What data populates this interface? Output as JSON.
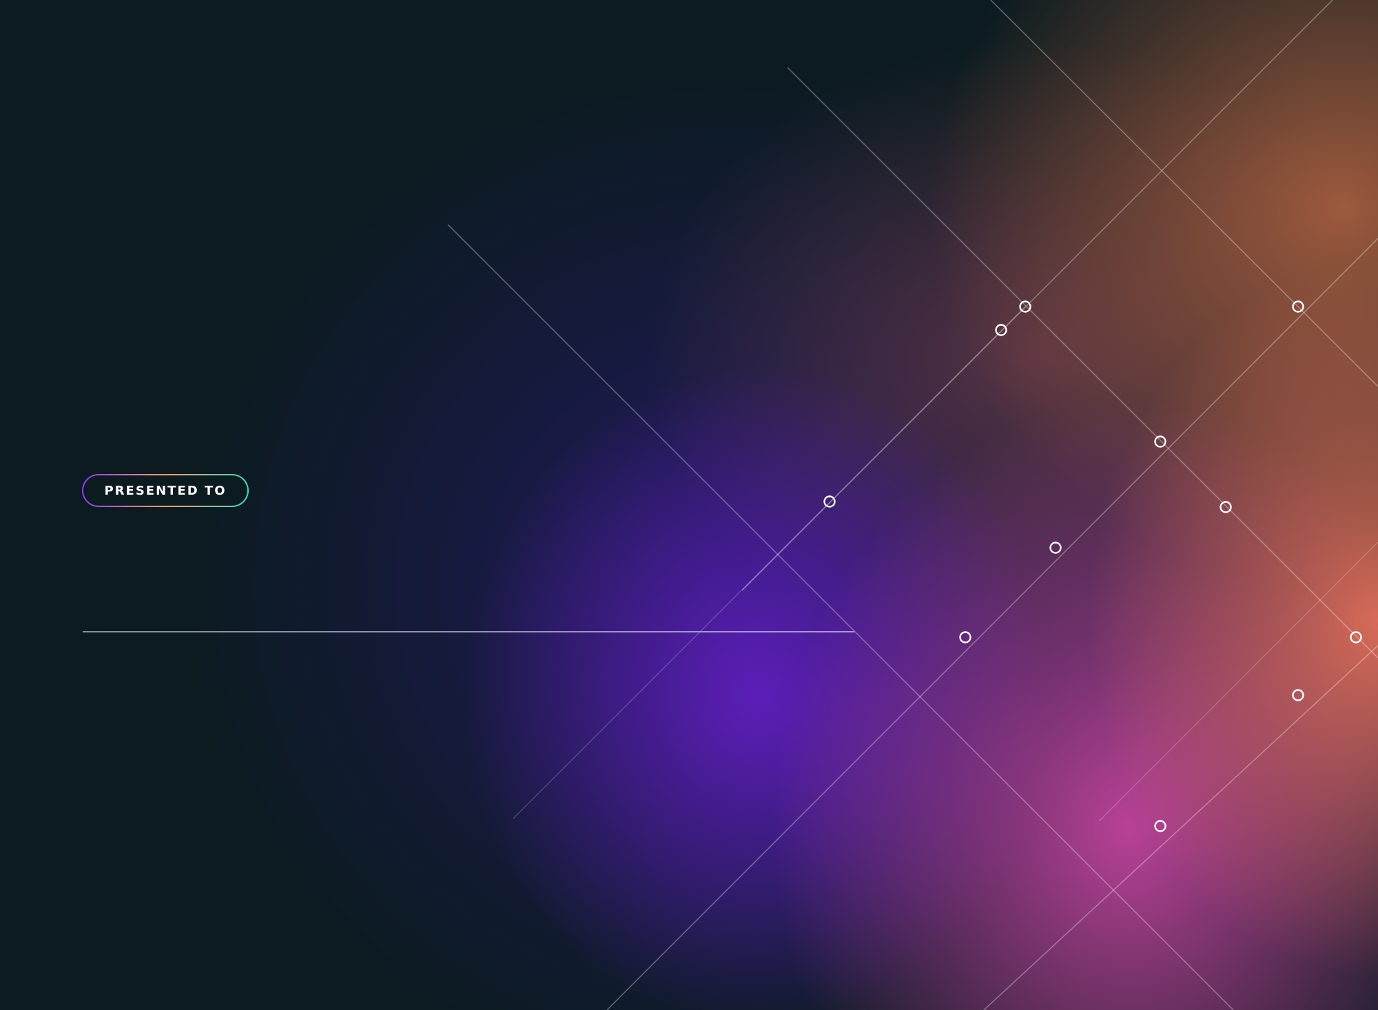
{
  "certificate": {
    "presented_label": "PRESENTED TO"
  },
  "colors": {
    "background": "#0b1b20",
    "glow_orange": "#f7785f",
    "glow_pink": "#d648aa",
    "glow_purple": "#601ebe",
    "glow_amber": "#cd6e46",
    "pill_gradient": [
      "#8a3cff",
      "#ff9a6a",
      "#2fe0c4"
    ]
  }
}
